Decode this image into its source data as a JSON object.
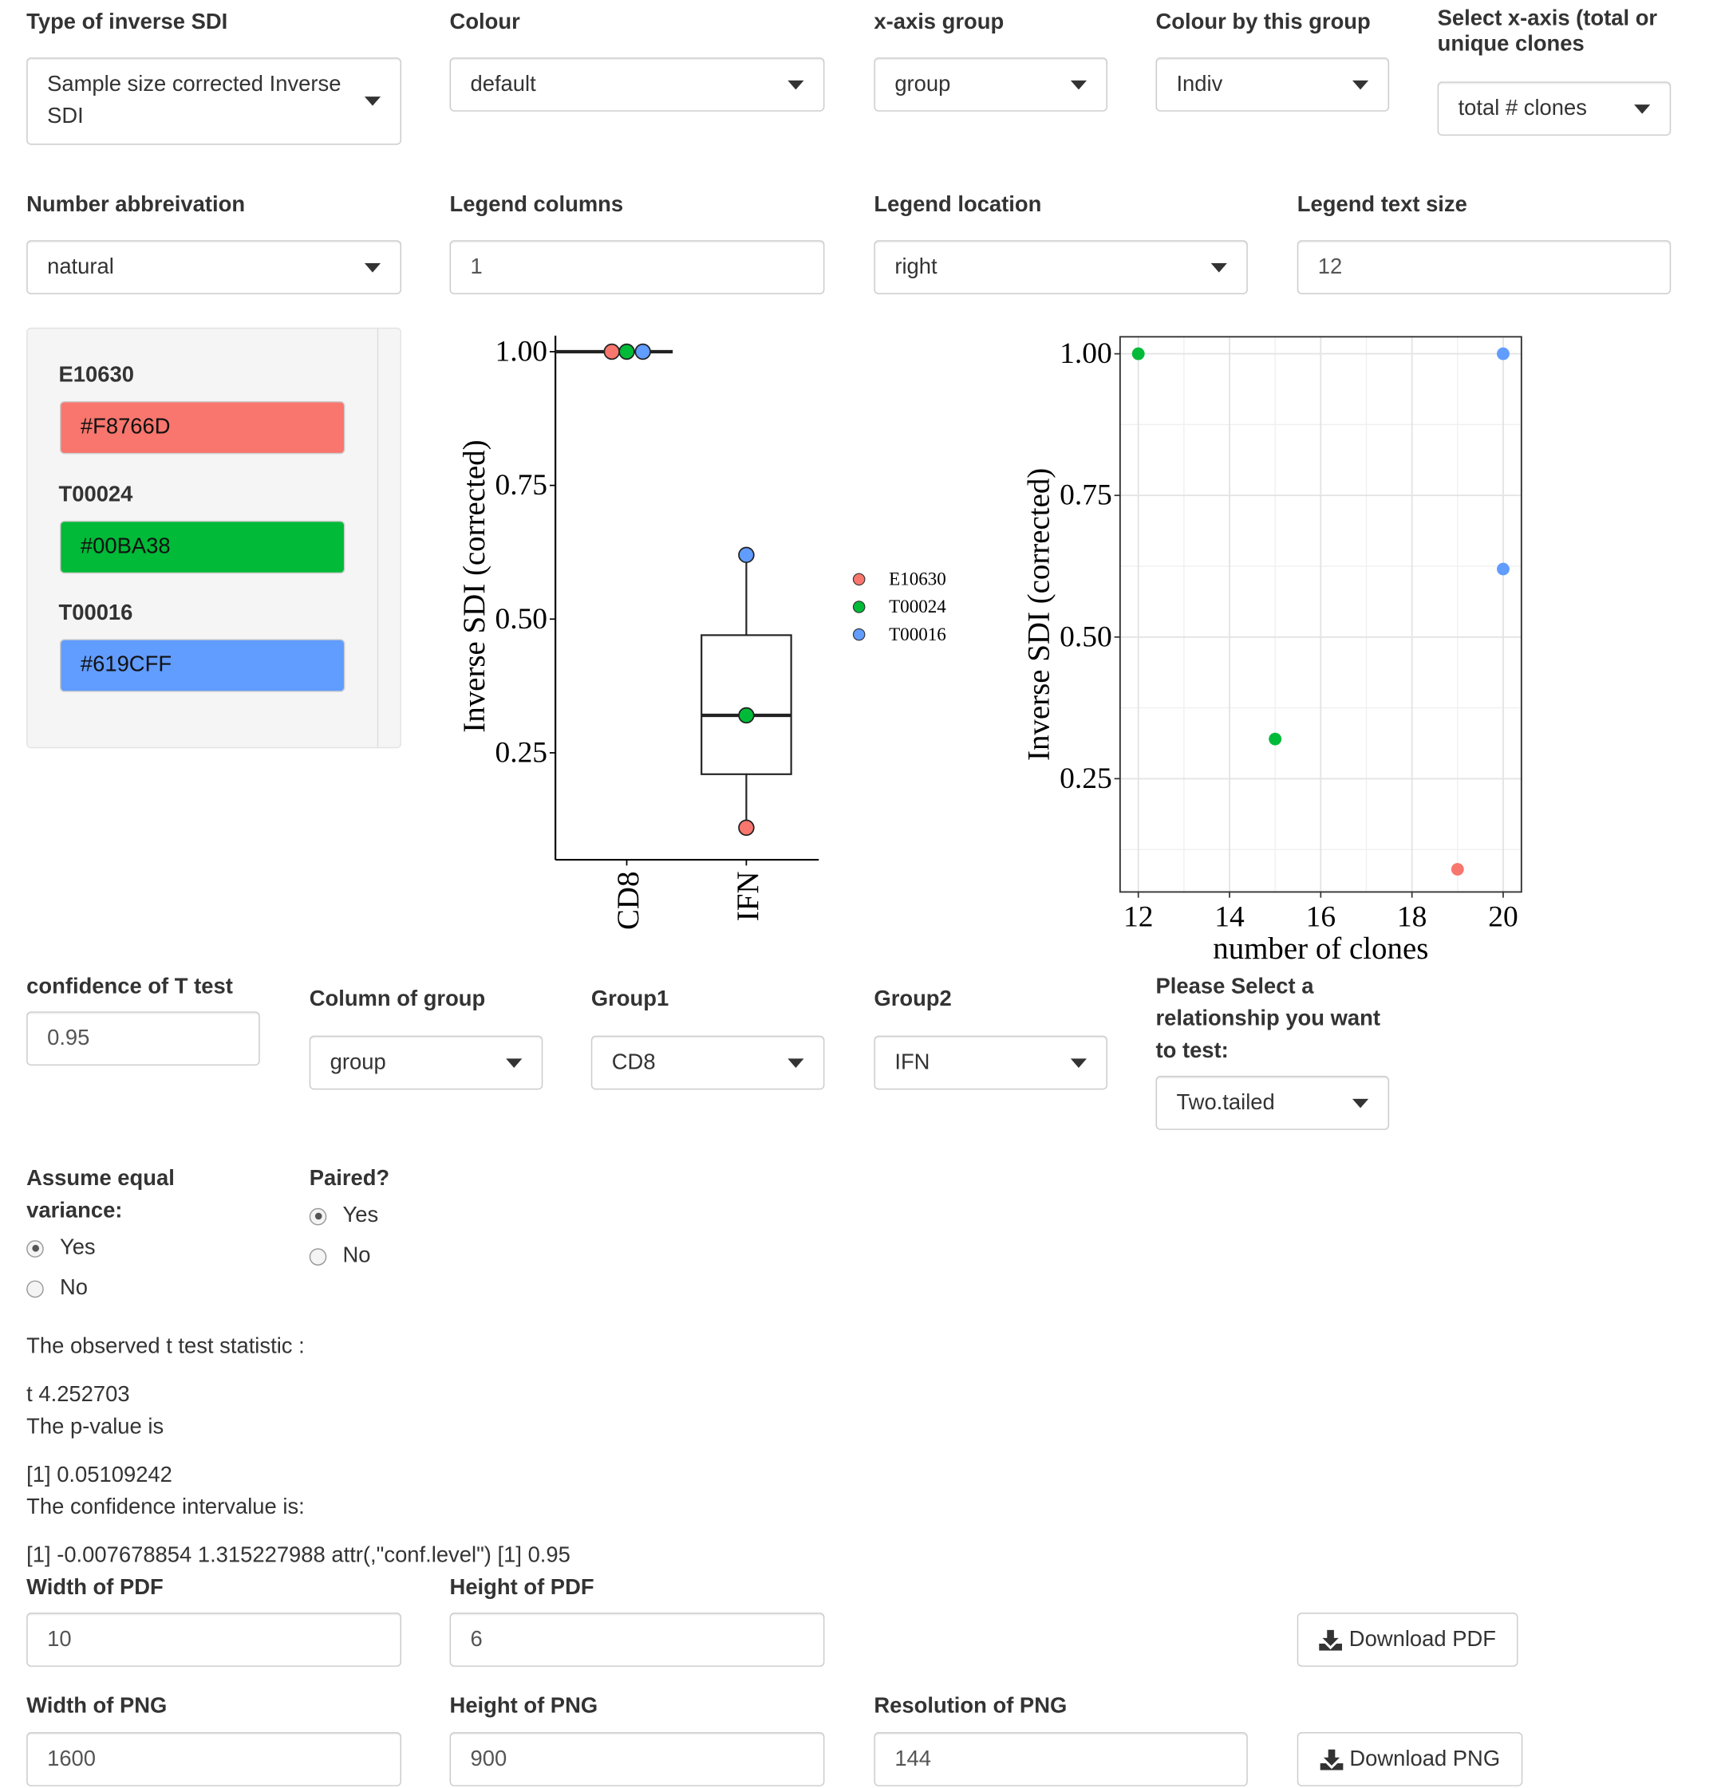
{
  "controls": {
    "type_sdi": {
      "label": "Type of inverse SDI",
      "value": "Sample size corrected Inverse SDI"
    },
    "colour": {
      "label": "Colour",
      "value": "default"
    },
    "xaxis_group": {
      "label": "x-axis group",
      "value": "group"
    },
    "colour_group": {
      "label": "Colour by this group",
      "value": "Indiv"
    },
    "xaxis_select": {
      "label": "Select x-axis (total or unique clones",
      "value": "total # clones"
    },
    "num_abbrev": {
      "label": "Number abbreivation",
      "value": "natural"
    },
    "legend_cols": {
      "label": "Legend columns",
      "value": "1"
    },
    "legend_loc": {
      "label": "Legend location",
      "value": "right"
    },
    "legend_size": {
      "label": "Legend text size",
      "value": "12"
    }
  },
  "colour_panel": [
    {
      "name": "E10630",
      "hex": "#F8766D"
    },
    {
      "name": "T00024",
      "hex": "#00BA38"
    },
    {
      "name": "T00016",
      "hex": "#619CFF"
    }
  ],
  "chart_data": [
    {
      "type": "box",
      "ylabel": "Inverse SDI (corrected)",
      "ylim": [
        0.05,
        1.03
      ],
      "yticks": [
        "0.25",
        "0.50",
        "0.75",
        "1.00"
      ],
      "categories": [
        "CD8",
        "IFN"
      ],
      "boxes": [
        {
          "category": "CD8",
          "min": 1.0,
          "q1": 1.0,
          "median": 1.0,
          "q3": 1.0,
          "max": 1.0
        },
        {
          "category": "IFN",
          "min": 0.11,
          "q1": 0.21,
          "median": 0.32,
          "q3": 0.47,
          "max": 0.62
        }
      ],
      "points": [
        {
          "category": "CD8",
          "series": "E10630",
          "y": 1.0
        },
        {
          "category": "CD8",
          "series": "T00024",
          "y": 1.0
        },
        {
          "category": "CD8",
          "series": "T00016",
          "y": 1.0
        },
        {
          "category": "IFN",
          "series": "T00016",
          "y": 0.62
        },
        {
          "category": "IFN",
          "series": "T00024",
          "y": 0.32
        },
        {
          "category": "IFN",
          "series": "E10630",
          "y": 0.11
        }
      ],
      "legend": [
        "E10630",
        "T00024",
        "T00016"
      ],
      "legend_position": "right",
      "colors": {
        "E10630": "#F8766D",
        "T00024": "#00BA38",
        "T00016": "#619CFF"
      }
    },
    {
      "type": "scatter",
      "xlabel": "number of clones",
      "ylabel": "Inverse SDI (corrected)",
      "xlim": [
        11.6,
        20.4
      ],
      "ylim": [
        0.05,
        1.03
      ],
      "xticks": [
        "12",
        "14",
        "16",
        "18",
        "20"
      ],
      "yticks": [
        "0.25",
        "0.50",
        "0.75",
        "1.00"
      ],
      "grid": true,
      "points": [
        {
          "x": 12,
          "y": 1.0,
          "series": "T00024"
        },
        {
          "x": 20,
          "y": 1.0,
          "series": "T00016"
        },
        {
          "x": 20,
          "y": 0.62,
          "series": "T00016"
        },
        {
          "x": 15,
          "y": 0.32,
          "series": "T00024"
        },
        {
          "x": 19,
          "y": 0.09,
          "series": "E10630"
        }
      ],
      "colors": {
        "E10630": "#F8766D",
        "T00024": "#00BA38",
        "T00016": "#619CFF"
      }
    }
  ],
  "ttest": {
    "confidence": {
      "label": "confidence of T test",
      "value": "0.95"
    },
    "column": {
      "label": "Column of group",
      "value": "group"
    },
    "group1": {
      "label": "Group1",
      "value": "CD8"
    },
    "group2": {
      "label": "Group2",
      "value": "IFN"
    },
    "relationship": {
      "label": "Please Select a relationship you want to test:",
      "value": "Two.tailed"
    },
    "equal_var": {
      "label": "Assume equal variance:",
      "options": [
        "Yes",
        "No"
      ],
      "selected": "Yes"
    },
    "paired": {
      "label": "Paired?",
      "options": [
        "Yes",
        "No"
      ],
      "selected": "Yes"
    },
    "output": {
      "stat_label": "The observed t test statistic :",
      "stat_value": "t 4.252703",
      "p_label": "The p-value is",
      "p_value": "[1] 0.05109242",
      "ci_label": "The confidence intervalue is:",
      "ci_value": "[1] -0.007678854 1.315227988 attr(,\"conf.level\") [1] 0.95"
    }
  },
  "export": {
    "pdf_width": {
      "label": "Width of PDF",
      "value": "10"
    },
    "pdf_height": {
      "label": "Height of PDF",
      "value": "6"
    },
    "pdf_button": "Download PDF",
    "png_width": {
      "label": "Width of PNG",
      "value": "1600"
    },
    "png_height": {
      "label": "Height of PNG",
      "value": "900"
    },
    "png_res": {
      "label": "Resolution of PNG",
      "value": "144"
    },
    "png_button": "Download PNG"
  }
}
